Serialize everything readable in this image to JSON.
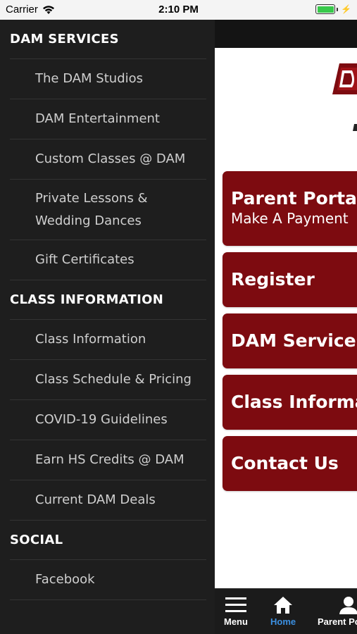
{
  "status": {
    "carrier": "Carrier",
    "time": "2:10 PM"
  },
  "menu": {
    "sections": [
      {
        "title": "DAM SERVICES",
        "items": [
          "The DAM Studios",
          "DAM Entertainment",
          "Custom Classes @ DAM",
          "Private Lessons & Wedding Dances",
          "Gift Certificates"
        ]
      },
      {
        "title": "CLASS INFORMATION",
        "items": [
          "Class Information",
          "Class Schedule & Pricing",
          "COVID-19 Guidelines",
          "Earn HS Credits @ DAM",
          "Current DAM Deals"
        ]
      },
      {
        "title": "SOCIAL",
        "items": [
          "Facebook"
        ]
      }
    ]
  },
  "main": {
    "cards": [
      {
        "title": "Parent Portal",
        "subtitle": "Make A Payment"
      },
      {
        "title": "Register"
      },
      {
        "title": "DAM Services"
      },
      {
        "title": "Class Information"
      },
      {
        "title": "Contact Us"
      }
    ]
  },
  "tabs": {
    "menu": "Menu",
    "home": "Home",
    "parent": "Parent Portal"
  },
  "colors": {
    "card": "#7d0b10",
    "active_tab": "#3b8fe0",
    "menu_bg": "#1e1e1e"
  }
}
